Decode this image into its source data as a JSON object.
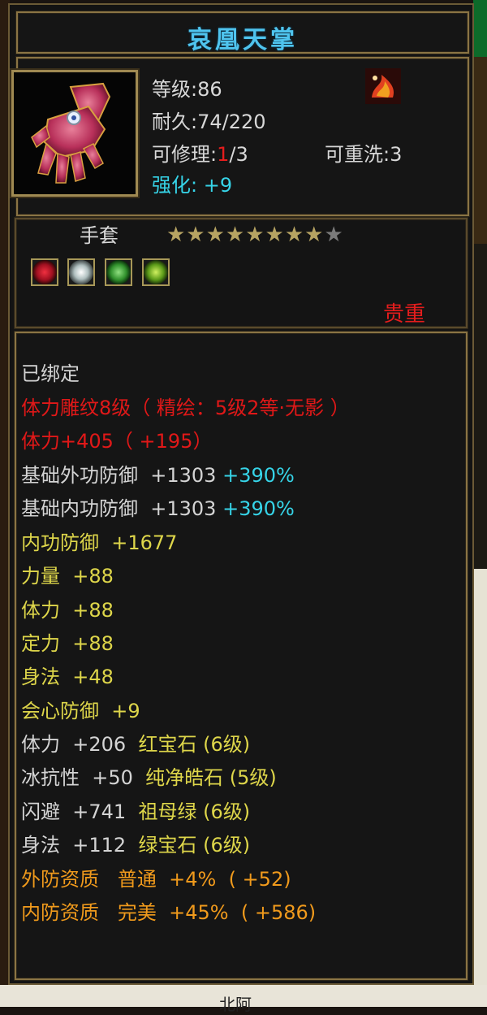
{
  "item": {
    "name": "哀凰天掌",
    "level_label": "等级",
    "level": "86",
    "durability_label": "耐久",
    "durability": "74/220",
    "repair_label": "可修理",
    "repair_current": "1",
    "repair_max": "/3",
    "rewash_label": "可重洗",
    "rewash_value": "3",
    "enhance_label": "强化",
    "enhance_value": "+9",
    "slot": "手套",
    "stars_total": 9,
    "stars_filled": 8,
    "stars_filled_glyphs": "★★★★★★★★",
    "stars_empty_glyphs": "★",
    "quality": "贵重",
    "gems": [
      {
        "icon": "red-gem-icon",
        "color": "#c81c24"
      },
      {
        "icon": "white-gem-icon",
        "color": "#cfd8d8"
      },
      {
        "icon": "green-gem-icon",
        "color": "#3aa040"
      },
      {
        "icon": "emerald-gem-icon",
        "color": "#6cb820"
      }
    ]
  },
  "attributes": {
    "bound": "已绑定",
    "engrave": "体力雕纹8级（ 精绘：5级2等·无影 ）",
    "stamina_bonus": "体力+405（ +195）",
    "ext_def_label": "基础外功防御  +1303",
    "ext_def_pct": "+390%",
    "int_def_label": "基础内功防御  +1303",
    "int_def_pct": "+390%",
    "lines_yellow": [
      "内功防御  +1677",
      "力量  +88",
      "体力  +88",
      "定力  +88",
      "身法  +48",
      "会心防御  +9"
    ],
    "gem_lines": [
      {
        "stat": "体力  +206",
        "gem": "红宝石 (6级)"
      },
      {
        "stat": "冰抗性  +50",
        "gem": "纯净皓石 (5级)"
      },
      {
        "stat": "闪避  +741",
        "gem": "祖母绿 (6级)"
      },
      {
        "stat": "身法  +112",
        "gem": "绿宝石 (6级)"
      }
    ],
    "ext_quality": "外防资质   普通  +4%  ( +52)",
    "int_quality": "内防资质   完美  +45%  ( +586)"
  },
  "footer": {
    "text": "北阿"
  }
}
